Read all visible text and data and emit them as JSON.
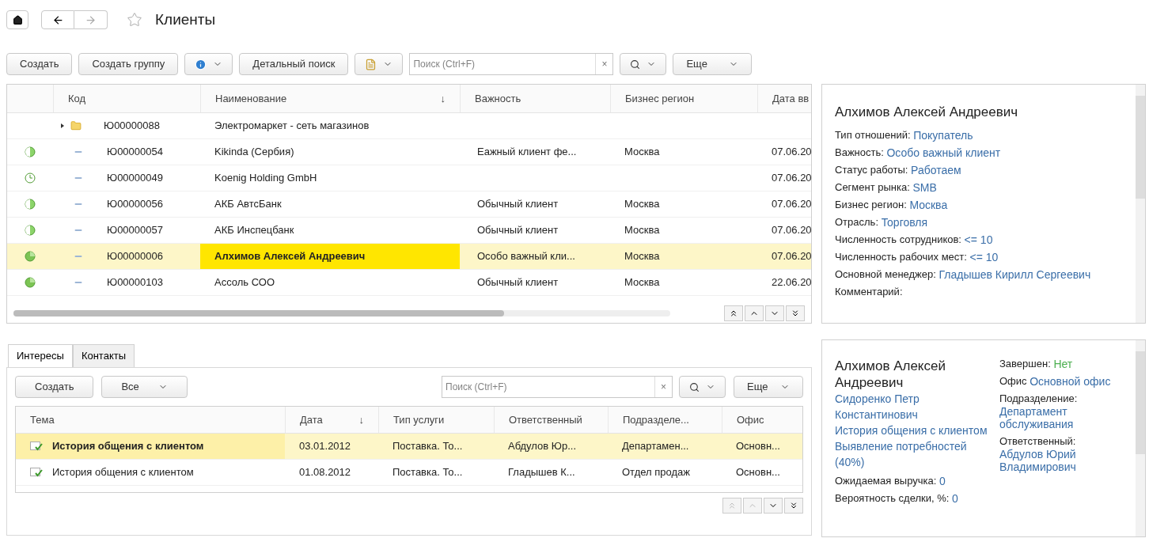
{
  "header": {
    "title": "Клиенты",
    "favorite": false
  },
  "toolbar": {
    "buttons": [
      {
        "kind": "text",
        "label": "Создать"
      },
      {
        "kind": "text",
        "label": "Создать группу"
      },
      {
        "kind": "info"
      },
      {
        "kind": "text",
        "label": "Детальный поиск"
      },
      {
        "kind": "report"
      }
    ],
    "search": {
      "placeholder": "Поиск (Ctrl+F)",
      "clear": "×"
    },
    "more": "Еще"
  },
  "table": {
    "columns": [
      {},
      {
        "label": "Код"
      },
      {
        "label": "Наименование",
        "sort": "↓"
      },
      {
        "label": "Важность"
      },
      {
        "label": "Бизнес регион"
      },
      {
        "label": "Дата вв"
      }
    ],
    "rows": [
      {
        "kind": "group",
        "code": "Ю00000088",
        "name": "Электромаркет - сеть магазинов",
        "importance": "",
        "region": "",
        "date": "",
        "selected": false
      },
      {
        "kind": "half",
        "code": "Ю00000054",
        "name": "Kikinda (Сербия)",
        "importance": "Еажный клиент фе...",
        "region": "Москва",
        "date": "07.06.20",
        "selected": false
      },
      {
        "kind": "clock",
        "code": "Ю00000049",
        "name": "Koenig Holding GmbH",
        "importance": "",
        "region": "",
        "date": "07.06.20",
        "selected": false
      },
      {
        "kind": "half",
        "code": "Ю00000056",
        "name": "АКБ АвтсБанк",
        "importance": "Обычный клиент",
        "region": "Москва",
        "date": "07.06.20",
        "selected": false
      },
      {
        "kind": "half",
        "code": "Ю00000057",
        "name": "АКБ Инспецбанк",
        "importance": "Обычный клиент",
        "region": "Москва",
        "date": "07.06.20",
        "selected": false
      },
      {
        "kind": "full",
        "code": "Ю00000006",
        "name": "Алхимов Алексей Андреевич",
        "importance": "Особо важный кли...",
        "region": "Москва",
        "date": "07.06.20",
        "selected": true
      },
      {
        "kind": "full",
        "code": "Ю00000103",
        "name": "Ассоль СОО",
        "importance": "Обычный клиент",
        "region": "Москва",
        "date": "22.06.20",
        "selected": false
      }
    ]
  },
  "details": {
    "title": "Алхимов Алексей Андреевич",
    "fields": [
      {
        "label": "Тип отношений:",
        "value": "Покупатель"
      },
      {
        "label": "Важность:",
        "value": "Особо важный клиент"
      },
      {
        "label": "Статус работы:",
        "value": "Работаем"
      },
      {
        "label": "Сегмент рынка:",
        "value": "SMB"
      },
      {
        "label": "Бизнес регион:",
        "value": "Москва"
      },
      {
        "label": "Отрасль:",
        "value": "Торговля"
      },
      {
        "label": "Численность сотрудников:",
        "value": "<= 10"
      },
      {
        "label": "Численность рабочих мест:",
        "value": "<= 10"
      },
      {
        "label": "Основной менеджер:",
        "value": "Гладышев Кирилл Сергеевич"
      },
      {
        "label": "Комментарий:"
      }
    ]
  },
  "tabs": [
    {
      "label": "Интересы",
      "selected": true
    },
    {
      "label": "Контакты",
      "selected": false
    }
  ],
  "sub_toolbar": {
    "create": "Создать",
    "filter": "Все",
    "search": {
      "placeholder": "Поиск (Ctrl+F)",
      "clear": "×"
    },
    "more": "Еще"
  },
  "sub_table": {
    "columns": [
      {
        "label": "Тема"
      },
      {
        "label": "Дата",
        "sort": "↓"
      },
      {
        "label": "Тип услуги"
      },
      {
        "label": "Ответственный"
      },
      {
        "label": "Подразделе..."
      },
      {
        "label": "Офис"
      }
    ],
    "rows": [
      {
        "cells": [
          "История общения с клиентом",
          "03.01.2012",
          "Поставка. То...",
          "Абдулов Юр...",
          "Департамен...",
          "Основн..."
        ],
        "selected": true
      },
      {
        "cells": [
          "История общения с клиентом",
          "01.08.2012",
          "Поставка. То...",
          "Гладышев К...",
          "Отдел продаж",
          "Основн..."
        ],
        "selected": false
      }
    ]
  },
  "interest_card": {
    "title": "Алхимов Алексей Андреевич",
    "links": [
      "Сидоренко Петр Константинович",
      "История общения с клиентом",
      "Выявление потребностей (40%)"
    ],
    "left_fields": [
      {
        "label": "Ожидаемая выручка:",
        "value": "0"
      },
      {
        "label": "Вероятность сделки, %:",
        "value": "0"
      }
    ],
    "right_fields": [
      {
        "label": "Завершен:",
        "value": "Нет",
        "color": "#4caf50"
      },
      {
        "label": "Офис",
        "value": "Основной офис",
        "color": "#3a6ea8"
      },
      {
        "label": "Подразделение:",
        "value": "Департамент обслуживания",
        "color": "#3a6ea8"
      },
      {
        "label": "Ответственный:",
        "value": "Абдулов Юрий Владимирович",
        "color": "#3a6ea8"
      }
    ]
  }
}
